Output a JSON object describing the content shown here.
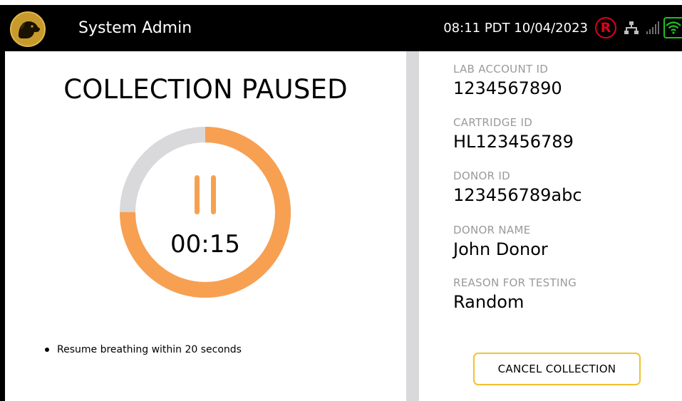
{
  "header": {
    "user_name": "System Admin",
    "clock": "08:11 PDT  10/04/2023",
    "registered_badge": "R",
    "icons": [
      "dog-logo-icon",
      "registered-icon",
      "network-icon",
      "cellular-signal-icon",
      "wifi-icon"
    ],
    "colors": {
      "bar": "#000000",
      "logo": "#c79a2d",
      "registered": "#e0001b",
      "wifi": "#20c020"
    }
  },
  "collection": {
    "title": "COLLECTION PAUSED",
    "timer": "00:15",
    "progress_fraction": 0.75,
    "colors": {
      "progress": "#f7a052",
      "track": "#d9d9dc"
    },
    "hint": "Resume breathing within 20 seconds"
  },
  "details": {
    "lab_account": {
      "label": "LAB ACCOUNT ID",
      "value": "1234567890"
    },
    "cartridge": {
      "label": "CARTRIDGE ID",
      "value": "HL123456789"
    },
    "donor_id": {
      "label": "DONOR ID",
      "value": "123456789abc"
    },
    "donor_name": {
      "label": "DONOR NAME",
      "value": "John Donor"
    },
    "reason": {
      "label": "REASON FOR TESTING",
      "value": "Random"
    }
  },
  "actions": {
    "cancel_label": "CANCEL COLLECTION",
    "cancel_border": "#f2c230"
  }
}
